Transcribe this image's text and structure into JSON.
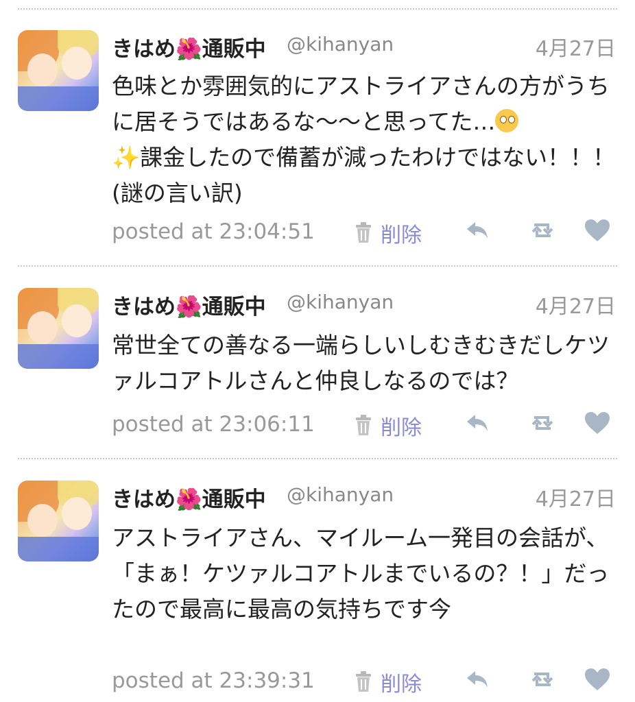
{
  "tweets": [
    {
      "user_name": "きはめ🌺通販中",
      "handle": "@kihanyan",
      "date": "4月27日",
      "text_before_emoji": "色味とか雰囲気的にアストライアさんの方がうちに居そうではあるな〜〜と思ってた…",
      "emoji_icon": "face-with-rolling-eyes-icon",
      "sparkle": "✨",
      "text_after_emoji": "課金したので備蓄が減ったわけではない！！！(謎の言い訳)",
      "posted": "posted at 23:04:51",
      "delete_label": "削除"
    },
    {
      "user_name": "きはめ🌺通販中",
      "handle": "@kihanyan",
      "date": "4月27日",
      "text": "常世全ての善なる一端らしいしむきむきだしケツァルコアトルさんと仲良しなるのでは？",
      "posted": "posted at 23:06:11",
      "delete_label": "削除"
    },
    {
      "user_name": "きはめ🌺通販中",
      "handle": "@kihanyan",
      "date": "4月27日",
      "text": "アストライアさん、マイルーム一発目の会話が、「まぁ！ケツァルコアトルまでいるの？！」だったので最高に最高の気持ちです今",
      "posted": "posted at 23:39:31",
      "delete_label": "削除"
    }
  ],
  "icons": {
    "avatar": "avatar-illustration",
    "trash": "trash-icon",
    "reply": "reply-icon",
    "retweet": "retweet-icon",
    "favorite": "heart-icon"
  },
  "colors": {
    "delete_link": "#8a8ad8",
    "action_icon": "#a9b6c6",
    "muted_text": "#999999",
    "separator": "#c8c8c8"
  }
}
